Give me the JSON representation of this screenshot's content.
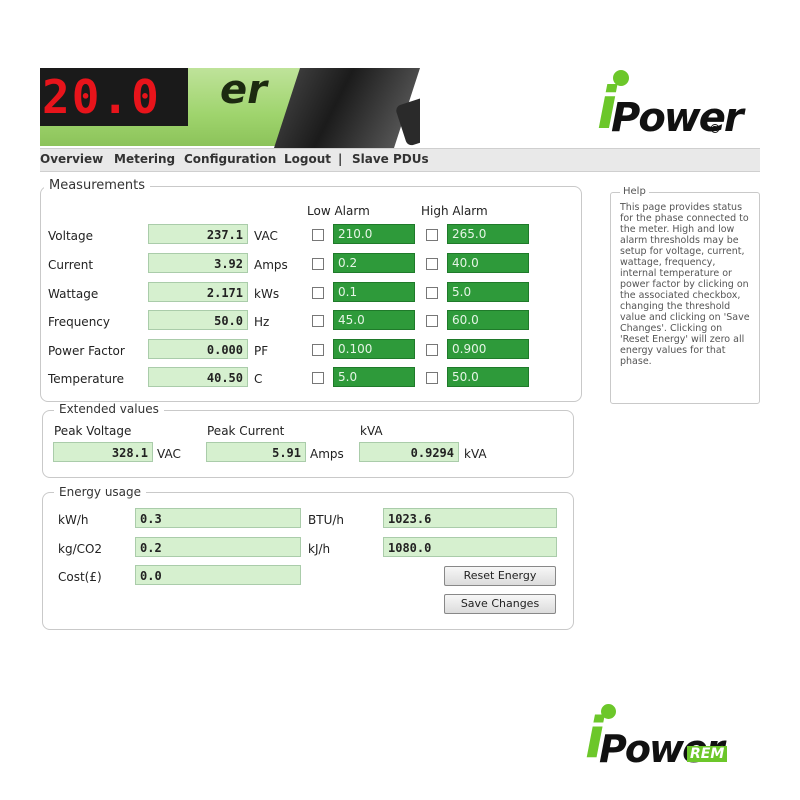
{
  "header": {
    "device_display": "20.0",
    "device_brand_fragment": "er"
  },
  "logo_top": {
    "text_i": "i",
    "text_ower": "Power",
    "registered": "®"
  },
  "nav": {
    "items": [
      {
        "label": "Overview"
      },
      {
        "label": "Metering"
      },
      {
        "label": "Configuration"
      },
      {
        "label": "Logout"
      },
      {
        "label": "|"
      },
      {
        "label": "Slave PDUs"
      }
    ]
  },
  "measurements": {
    "legend": "Measurements",
    "low_alarm_header": "Low Alarm",
    "high_alarm_header": "High Alarm",
    "rows": [
      {
        "label": "Voltage",
        "value": "237.1",
        "unit": "VAC",
        "low": "210.0",
        "high": "265.0"
      },
      {
        "label": "Current",
        "value": "3.92",
        "unit": "Amps",
        "low": "0.2",
        "high": "40.0"
      },
      {
        "label": "Wattage",
        "value": "2.171",
        "unit": "kWs",
        "low": "0.1",
        "high": "5.0"
      },
      {
        "label": "Frequency",
        "value": "50.0",
        "unit": "Hz",
        "low": "45.0",
        "high": "60.0"
      },
      {
        "label": "Power Factor",
        "value": "0.000",
        "unit": "PF",
        "low": "0.100",
        "high": "0.900"
      },
      {
        "label": "Temperature",
        "value": "40.50",
        "unit": "C",
        "low": "5.0",
        "high": "50.0"
      }
    ]
  },
  "extended": {
    "legend": "Extended values",
    "items": [
      {
        "label": "Peak Voltage",
        "value": "328.1",
        "unit": "VAC"
      },
      {
        "label": "Peak Current",
        "value": "5.91",
        "unit": "Amps"
      },
      {
        "label": "kVA",
        "value": "0.9294",
        "unit": "kVA"
      }
    ]
  },
  "energy": {
    "legend": "Energy usage",
    "kwh_label": "kW/h",
    "kwh_value": "0.3",
    "btu_label": "BTU/h",
    "btu_value": "1023.6",
    "co2_label": "kg/CO2",
    "co2_value": "0.2",
    "kj_label": "kJ/h",
    "kj_value": "1080.0",
    "cost_label": "Cost(£)",
    "cost_value": "0.0",
    "reset_button": "Reset Energy",
    "save_button": "Save Changes"
  },
  "help": {
    "legend": "Help",
    "text": "This page provides status for the phase connected to the meter. High and low alarm thresholds may be setup for voltage, current, wattage, frequency, internal temperature or power factor by clicking on the associated checkbox, changing the threshold value and clicking on 'Save Changes'. Clicking on 'Reset Energy' will zero all energy values for that phase."
  },
  "logo_bottom": {
    "text_i": "i",
    "text_ower": "Power",
    "suffix": "REM"
  },
  "colors": {
    "brand_green": "#6cc72a",
    "alarm_green": "#2e9a3a",
    "value_bg": "#d6f0cf"
  }
}
